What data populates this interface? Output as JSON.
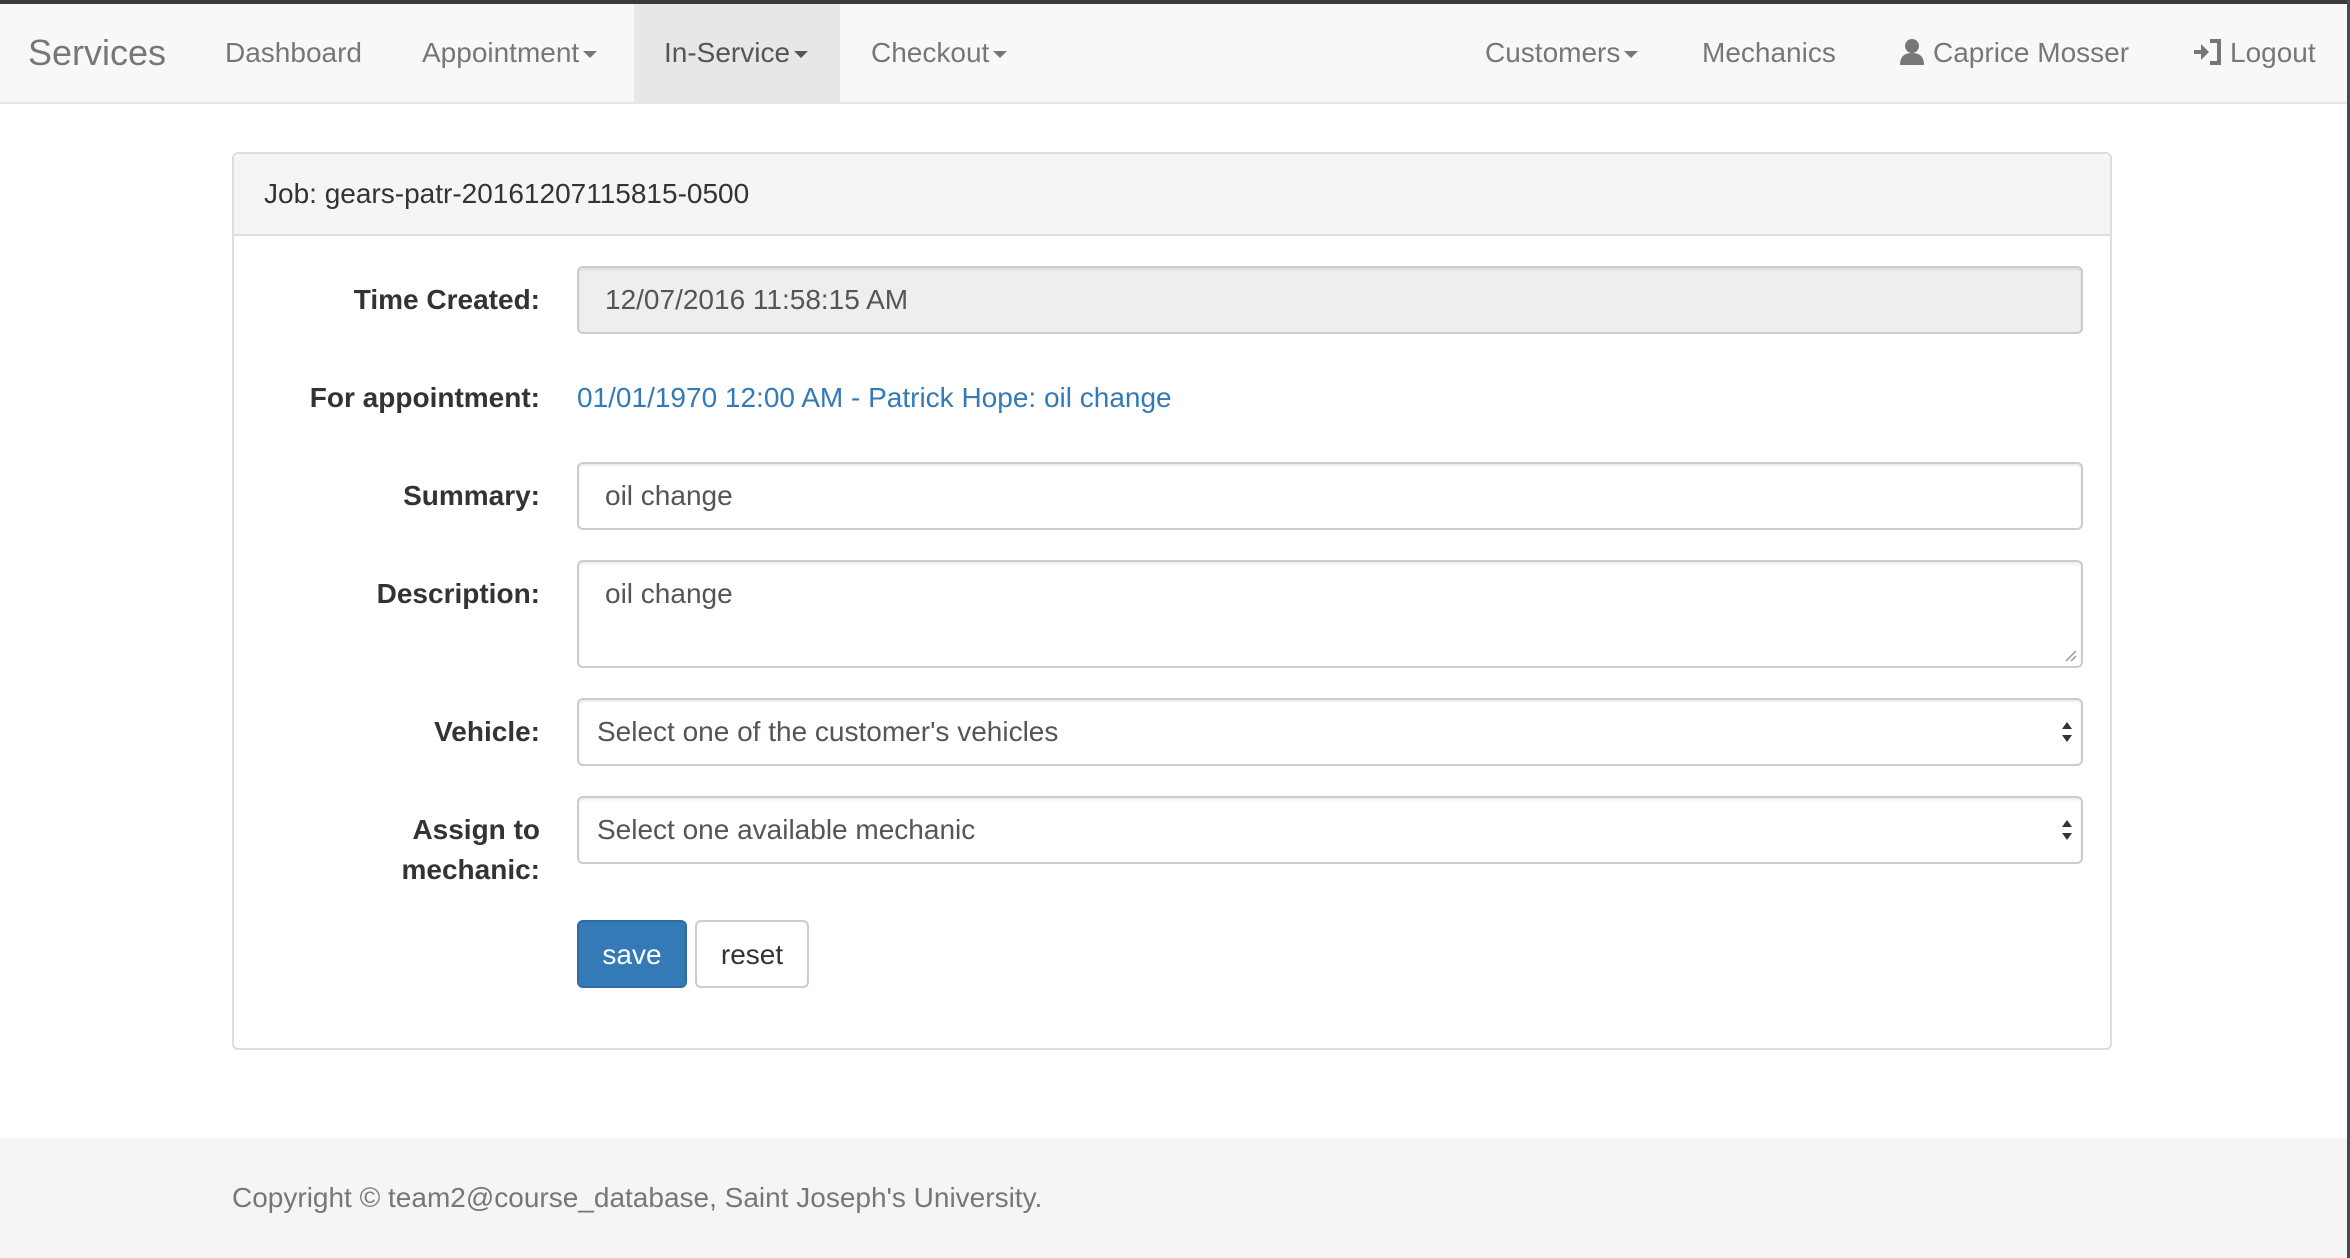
{
  "navbar": {
    "brand": "Services",
    "items": [
      {
        "label": "Dashboard"
      },
      {
        "label": "Appointment"
      },
      {
        "label": "In-Service"
      },
      {
        "label": "Checkout"
      }
    ],
    "right_items": [
      {
        "label": "Customers"
      },
      {
        "label": "Mechanics"
      },
      {
        "label": "Caprice Mosser",
        "icon": "user-icon"
      },
      {
        "label": "Logout",
        "icon": "logout-icon"
      }
    ],
    "active_item": "In-Service"
  },
  "panel": {
    "heading": "Job: gears-patr-20161207115815-0500"
  },
  "form": {
    "time_created": {
      "label": "Time Created:",
      "value": "12/07/2016 11:58:15 AM"
    },
    "appointment": {
      "label": "For appointment:",
      "link_text": "01/01/1970 12:00 AM - Patrick Hope: oil change"
    },
    "summary": {
      "label": "Summary:",
      "value": "oil change"
    },
    "description": {
      "label": "Description:",
      "value": "oil change"
    },
    "vehicle": {
      "label": "Vehicle:",
      "selected": "Select one of the customer's vehicles"
    },
    "mechanic": {
      "label_line1": "Assign to",
      "label_line2": "mechanic:",
      "selected": "Select one available mechanic"
    },
    "save_label": "save",
    "reset_label": "reset"
  },
  "footer": {
    "text": "Copyright © team2@course_database, Saint Joseph's University."
  },
  "colors": {
    "primary": "#337ab7",
    "link": "#337ab7",
    "navbar_bg": "#f8f8f8",
    "active_tab_bg": "#e7e7e7"
  }
}
